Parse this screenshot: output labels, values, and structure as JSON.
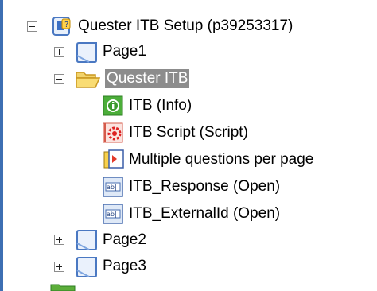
{
  "tree": {
    "root": {
      "label": "Quester ITB Setup (p39253317)",
      "icon": "setup-page-icon",
      "expanded": true
    },
    "items": [
      {
        "label": "Page1",
        "icon": "page-icon",
        "expanded": false
      },
      {
        "label": "Quester ITB",
        "icon": "open-folder-icon",
        "expanded": true,
        "selected": true,
        "children": [
          {
            "label": "ITB (Info)",
            "icon": "info-icon"
          },
          {
            "label": "ITB Script (Script)",
            "icon": "script-gear-icon"
          },
          {
            "label": "Multiple questions per page",
            "icon": "multi-question-icon"
          },
          {
            "label": "ITB_Response (Open)",
            "icon": "text-field-icon"
          },
          {
            "label": "ITB_ExternalId (Open)",
            "icon": "text-field-icon"
          }
        ]
      },
      {
        "label": "Page2",
        "icon": "page-icon",
        "expanded": false
      },
      {
        "label": "Page3",
        "icon": "page-icon",
        "expanded": false
      }
    ]
  },
  "colors": {
    "selection": "#8c8c8c",
    "accent": "#3d6fb3"
  }
}
